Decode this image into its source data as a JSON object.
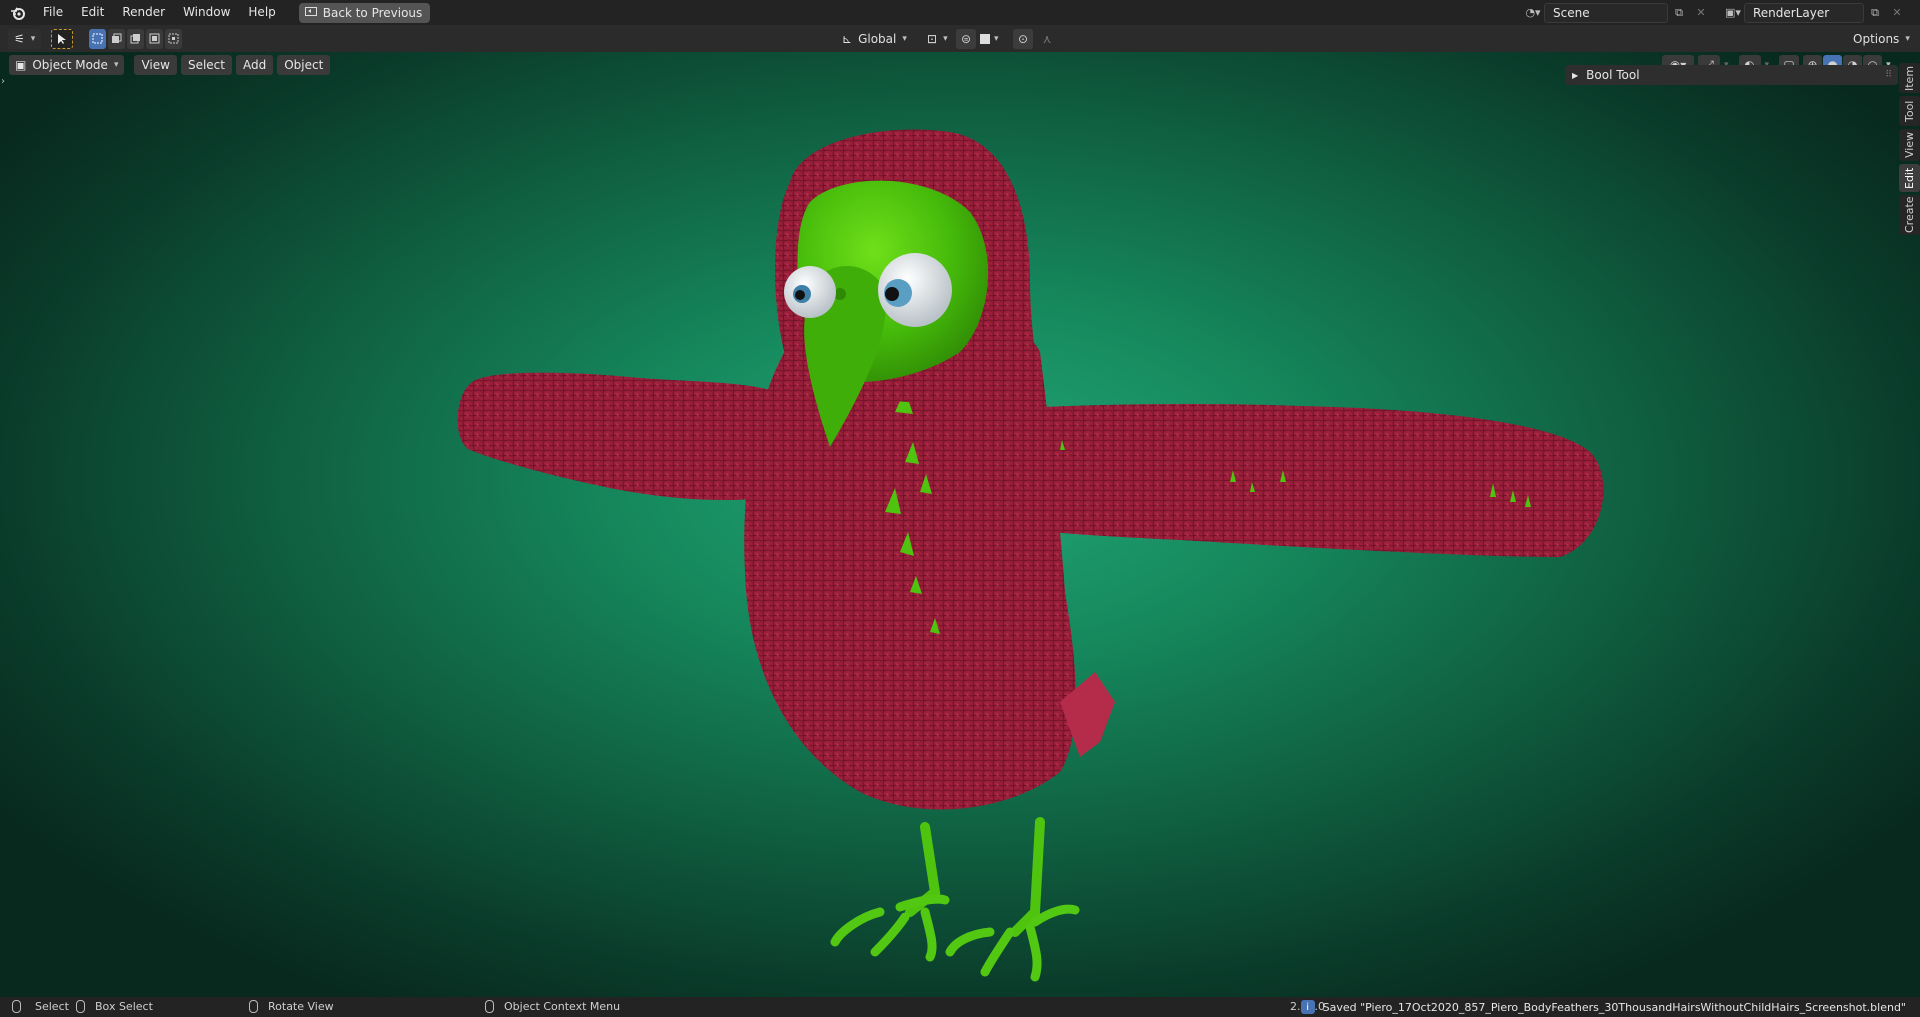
{
  "menubar": {
    "items": [
      "File",
      "Edit",
      "Render",
      "Window",
      "Help"
    ],
    "back_button": "Back to Previous",
    "scene": "Scene",
    "render_layer": "RenderLayer"
  },
  "toolbar": {
    "orientation": "Global",
    "options": "Options"
  },
  "viewport": {
    "mode": "Object Mode",
    "menus": [
      "View",
      "Select",
      "Add",
      "Object"
    ],
    "panel_title": "Bool Tool",
    "side_tabs": [
      "Item",
      "Tool",
      "View",
      "Edit",
      "Create"
    ],
    "active_tab": "Edit",
    "background_colors": [
      "#22a576",
      "#08291e"
    ]
  },
  "statusbar": {
    "select": "Select",
    "box_select": "Box Select",
    "rotate_view": "Rotate View",
    "context_menu": "Object Context Menu",
    "version": "2.90.0",
    "message": "Saved \"Piero_17Oct2020_857_Piero_BodyFeathers_30ThousandHairsWithoutChildHairs_Screenshot.blend\""
  },
  "icons": [
    "blender-logo-icon",
    "cursor-icon",
    "select-box-icon",
    "snap-icon",
    "proportional-icon",
    "overlay-icon",
    "shading-solid-icon"
  ]
}
